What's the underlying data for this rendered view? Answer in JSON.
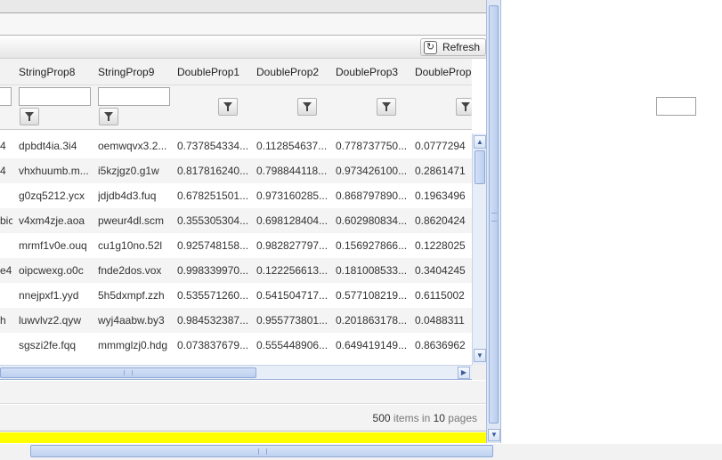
{
  "toolbar": {
    "refresh_label": "Refresh",
    "refresh_icon": "↻"
  },
  "columns": [
    {
      "label": "StringProp8",
      "filter": "text",
      "filter_value": ""
    },
    {
      "label": "StringProp9",
      "filter": "text",
      "filter_value": ""
    },
    {
      "label": "DoubleProp1",
      "filter": "button"
    },
    {
      "label": "DoubleProp2",
      "filter": "button"
    },
    {
      "label": "DoubleProp3",
      "filter": "button"
    },
    {
      "label": "DoubleProp",
      "filter": "button"
    }
  ],
  "rows": [
    {
      "c0": "4",
      "c1": "dpbdt4ia.3i4",
      "c2": "oemwqvx3.2...",
      "c3": "0.737854334...",
      "c4": "0.112854637...",
      "c5": "0.778737750...",
      "c6": "0.0777294"
    },
    {
      "c0": "4",
      "c1": "vhxhuumb.m...",
      "c2": "i5kzjgz0.g1w",
      "c3": "0.817816240...",
      "c4": "0.798844118...",
      "c5": "0.973426100...",
      "c6": "0.2861471"
    },
    {
      "c0": "",
      "c1": "g0zq5212.ycx",
      "c2": "jdjdb4d3.fuq",
      "c3": "0.678251501...",
      "c4": "0.973160285...",
      "c5": "0.868797890...",
      "c6": "0.1963496"
    },
    {
      "c0": "bic",
      "c1": "v4xm4zje.aoa",
      "c2": "pweur4dl.scm",
      "c3": "0.355305304...",
      "c4": "0.698128404...",
      "c5": "0.602980834...",
      "c6": "0.8620424"
    },
    {
      "c0": "",
      "c1": "mrmf1v0e.ouq",
      "c2": "cu1g10no.52l",
      "c3": "0.925748158...",
      "c4": "0.982827797...",
      "c5": "0.156927866...",
      "c6": "0.1228025"
    },
    {
      "c0": "e4",
      "c1": "oipcwexg.o0c",
      "c2": "fnde2dos.vox",
      "c3": "0.998339970...",
      "c4": "0.122256613...",
      "c5": "0.181008533...",
      "c6": "0.3404245"
    },
    {
      "c0": "",
      "c1": "nnejpxf1.yyd",
      "c2": "5h5dxmpf.zzh",
      "c3": "0.535571260...",
      "c4": "0.541504717...",
      "c5": "0.577108219...",
      "c6": "0.6115002"
    },
    {
      "c0": "h",
      "c1": "luwvlvz2.qyw",
      "c2": "wyj4aabw.by3",
      "c3": "0.984532387...",
      "c4": "0.955773801...",
      "c5": "0.201863178...",
      "c6": "0.0488311"
    },
    {
      "c0": "",
      "c1": "sgszi2fe.fqq",
      "c2": "mmmglzj0.hdg",
      "c3": "0.073837679...",
      "c4": "0.555448906...",
      "c5": "0.649419149...",
      "c6": "0.8636962"
    }
  ],
  "pager": {
    "count": "500",
    "items_in": "items in",
    "pages": "10",
    "pages_label": "pages"
  },
  "colors": {
    "highlight_bar": "#ffff00",
    "scroll_accent": "#bcd0f0"
  },
  "icons": {
    "up": "▲",
    "down": "▼",
    "right": "▶"
  }
}
